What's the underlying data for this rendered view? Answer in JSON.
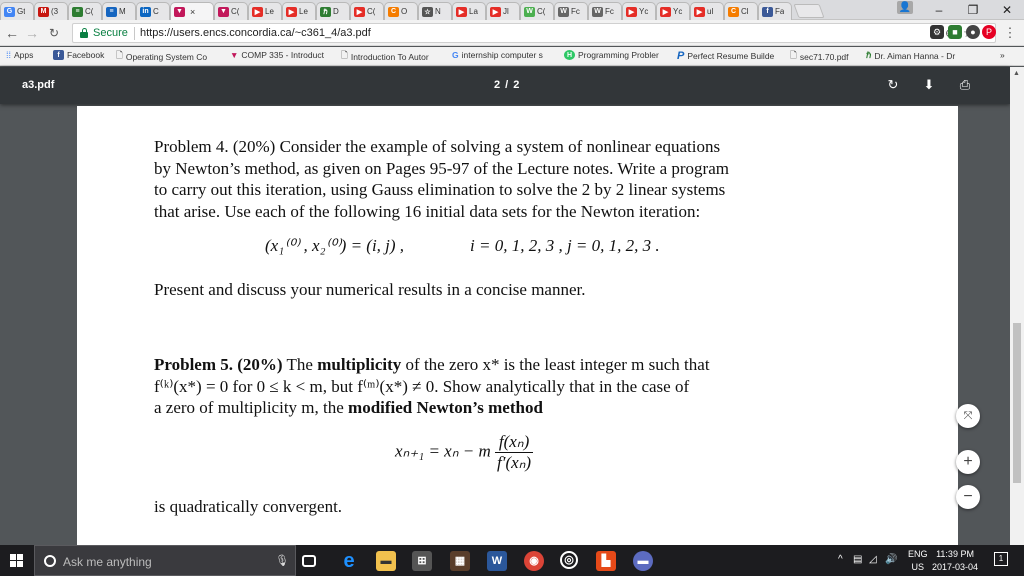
{
  "browser": {
    "tabs": [
      {
        "label": "Gt",
        "icon": "google-icon",
        "color": "#4285f4",
        "glyph": "G"
      },
      {
        "label": "(3",
        "icon": "mail-icon",
        "color": "#c71610",
        "glyph": "M"
      },
      {
        "label": "C(",
        "icon": "sheet-icon",
        "color": "#2e7d32",
        "glyph": "≡"
      },
      {
        "label": "M",
        "icon": "menu-icon",
        "color": "#1565c0",
        "glyph": "≡"
      },
      {
        "label": "C",
        "icon": "linkedin-icon",
        "color": "#0a66c2",
        "glyph": "in"
      },
      {
        "label": "",
        "icon": "comp-icon",
        "color": "#c2185b",
        "glyph": "▼",
        "active": true
      },
      {
        "label": "C(",
        "icon": "comp-icon",
        "color": "#c2185b",
        "glyph": "▼"
      },
      {
        "label": "Le",
        "icon": "youtube-icon",
        "color": "#e52d27",
        "glyph": "▶"
      },
      {
        "label": "Le",
        "icon": "youtube-icon",
        "color": "#e52d27",
        "glyph": "▶"
      },
      {
        "label": "D",
        "icon": "hanna-icon",
        "color": "#2e7d32",
        "glyph": "ℏ"
      },
      {
        "label": "C(",
        "icon": "youtube-icon",
        "color": "#e52d27",
        "glyph": "▶"
      },
      {
        "label": "O",
        "icon": "c-icon",
        "color": "#f57c00",
        "glyph": "C"
      },
      {
        "label": "N",
        "icon": "star-icon",
        "color": "#555555",
        "glyph": "☆"
      },
      {
        "label": "La",
        "icon": "youtube-icon",
        "color": "#e52d27",
        "glyph": "▶"
      },
      {
        "label": "Jl",
        "icon": "youtube-icon",
        "color": "#e52d27",
        "glyph": "▶"
      },
      {
        "label": "C(",
        "icon": "wordpress-icon",
        "color": "#4caf50",
        "glyph": "W"
      },
      {
        "label": "Fc",
        "icon": "wiki-icon",
        "color": "#666666",
        "glyph": "W"
      },
      {
        "label": "Fc",
        "icon": "wiki-icon",
        "color": "#666666",
        "glyph": "W"
      },
      {
        "label": "Yc",
        "icon": "youtube-icon",
        "color": "#e52d27",
        "glyph": "▶"
      },
      {
        "label": "Yc",
        "icon": "youtube-icon",
        "color": "#e52d27",
        "glyph": "▶"
      },
      {
        "label": "ul",
        "icon": "youtube-icon",
        "color": "#e52d27",
        "glyph": "▶"
      },
      {
        "label": "Cl",
        "icon": "c-icon",
        "color": "#f57c00",
        "glyph": "C"
      },
      {
        "label": "Fa",
        "icon": "facebook-icon",
        "color": "#3b5998",
        "glyph": "f"
      }
    ],
    "active_tab_close": "×",
    "window_controls": {
      "minimize": "–",
      "restore": "❐",
      "close": "✕"
    },
    "nav": {
      "back": "←",
      "forward": "→",
      "reload": "C"
    },
    "address": {
      "secure_label": "Secure",
      "url": "https://users.encs.concordia.ca/~c361_4/a3.pdf"
    },
    "omnibox_icons": {
      "zoom": "⊕",
      "star": "☆"
    },
    "menu_glyph": "⋮",
    "bookmarks": [
      {
        "label": "Apps",
        "icon": "apps-icon"
      },
      {
        "label": "Facebook",
        "icon": "facebook-icon"
      },
      {
        "label": "Operating System Co",
        "icon": "page-icon"
      },
      {
        "label": "COMP 335 - Introduct",
        "icon": "comp-icon"
      },
      {
        "label": "Introduction To Autor",
        "icon": "page-icon"
      },
      {
        "label": "internship computer s",
        "icon": "google-icon"
      },
      {
        "label": "Programming Probler",
        "icon": "hackerrank-icon"
      },
      {
        "label": "Perfect Resume Builde",
        "icon": "p-icon"
      },
      {
        "label": "sec71.70.pdf",
        "icon": "page-icon"
      },
      {
        "label": "Dr. Aiman Hanna - Dr",
        "icon": "hanna-icon"
      }
    ],
    "bookmarks_more": "»"
  },
  "pdf_viewer": {
    "file_name": "a3.pdf",
    "page_indicator": "2 / 2",
    "zoom_controls": {
      "fit": "⤧",
      "plus": "+",
      "minus": "−"
    }
  },
  "document": {
    "p4_lines": [
      "Problem 4. (20%)  Consider the example of solving a system of nonlinear equations",
      "by Newton’s method, as given on Pages 95-97 of the Lecture notes. Write a program",
      "to carry out this iteration, using Gauss elimination to solve the 2 by 2 linear systems",
      "that arise. Use each of the following 16 initial data sets for the Newton iteration:"
    ],
    "p4_eq_left": "(x₁⁽⁰⁾ , x₂⁽⁰⁾)  =  (i, j) ,",
    "p4_eq_right": "i = 0, 1, 2, 3 ,     j = 0, 1, 2, 3 .",
    "p4_after": "Present and discuss your numerical results in a concise manner.",
    "p5_heading": "Problem 5. (20%)",
    "p5_line1_a": " The ",
    "p5_line1_bold": "multiplicity",
    "p5_line1_b": " of the zero x* is the least integer m such that",
    "p5_line2": "f⁽ᵏ⁾(x*) = 0 for 0 ≤ k < m, but f⁽ᵐ⁾(x*) ≠ 0. Show analytically that in the case of",
    "p5_line3_a": "a zero of multiplicity m, the ",
    "p5_line3_bold": "modified Newton’s method",
    "p5_eq_lhs": "xₙ₊₁ = xₙ − m",
    "p5_eq_num": "f(xₙ)",
    "p5_eq_den": "f′(xₙ)",
    "p5_after": "is quadratically convergent."
  },
  "taskbar": {
    "search_placeholder": "Ask me anything",
    "tray_lang": "ENG",
    "tray_region": "US",
    "time": "11:39 PM",
    "date": "2017-03-04",
    "notification_count": "1"
  }
}
